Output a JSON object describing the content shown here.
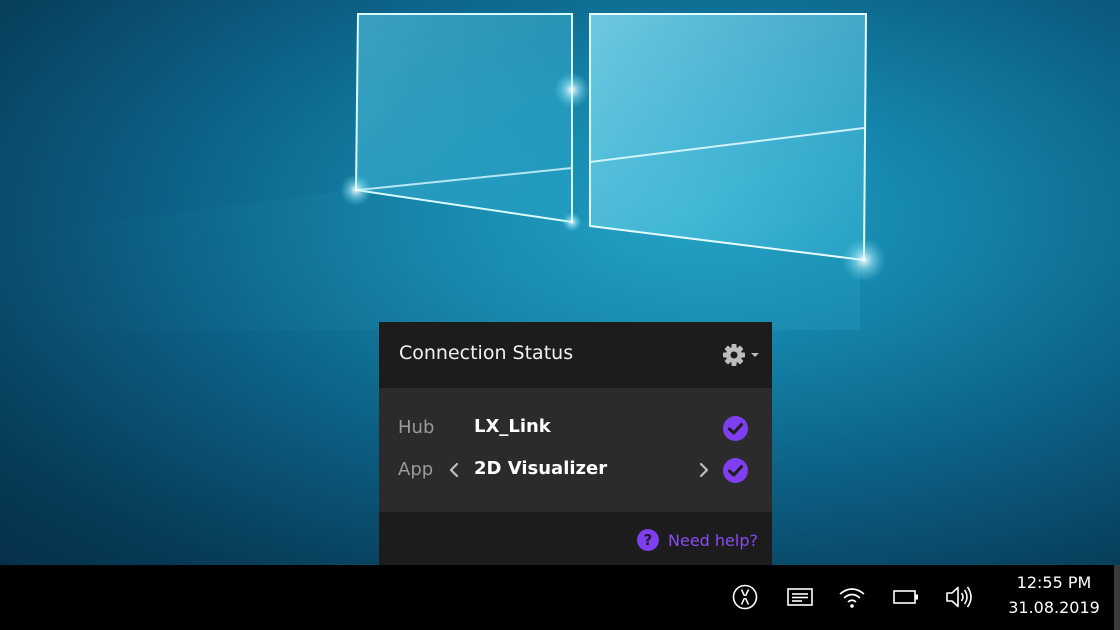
{
  "panel": {
    "title": "Connection Status",
    "settings_icon": "gear-icon",
    "rows": [
      {
        "label": "Hub",
        "value": "LX_Link",
        "status": "connected"
      },
      {
        "label": "App",
        "value": "2D Visualizer",
        "status": "connected"
      }
    ],
    "help_label": "Need help?",
    "accent_color": "#7f3ff0"
  },
  "taskbar": {
    "tray_icons": [
      "app-tray-icon",
      "action-center-icon",
      "wifi-icon",
      "battery-icon",
      "volume-icon"
    ],
    "clock": {
      "time": "12:55 PM",
      "date": "31.08.2019"
    }
  }
}
